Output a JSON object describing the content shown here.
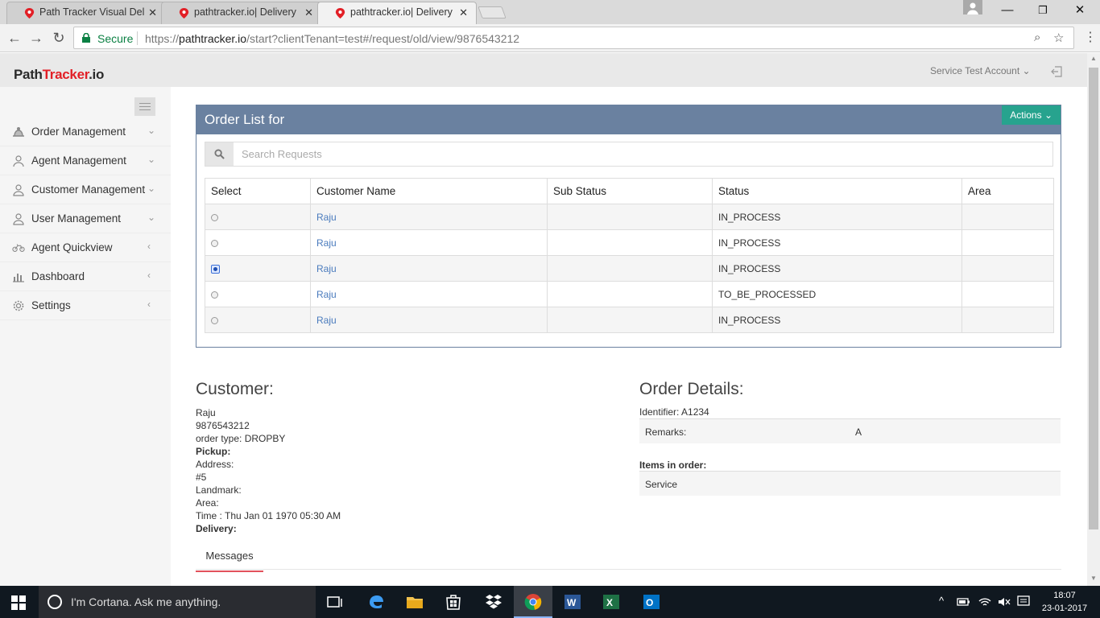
{
  "browser": {
    "tabs": [
      {
        "title": "Path Tracker Visual Delive",
        "active": false
      },
      {
        "title": "pathtracker.io| Delivery P",
        "active": false
      },
      {
        "title": "pathtracker.io| Delivery P",
        "active": true
      }
    ],
    "secure_label": "Secure",
    "url_scheme": "https://",
    "url_host": "pathtracker.io",
    "url_path": "/start?clientTenant=test#/request/old/view/9876543212"
  },
  "header": {
    "logo_part1": "Path",
    "logo_part2": "Tracker",
    "logo_part3": ".io",
    "account_label": "Service Test Account"
  },
  "sidebar": {
    "items": [
      {
        "label": "Order Management",
        "icon": "truck-icon",
        "chevron": "⌄"
      },
      {
        "label": "Agent Management",
        "icon": "agent-icon",
        "chevron": "⌄"
      },
      {
        "label": "Customer Management",
        "icon": "user-icon",
        "chevron": "⌄"
      },
      {
        "label": "User Management",
        "icon": "user-icon",
        "chevron": "⌄"
      },
      {
        "label": "Agent Quickview",
        "icon": "bike-icon",
        "chevron": "‹"
      },
      {
        "label": "Dashboard",
        "icon": "bar-chart-icon",
        "chevron": "‹"
      },
      {
        "label": "Settings",
        "icon": "gear-icon",
        "chevron": "‹"
      }
    ]
  },
  "order_list": {
    "title": "Order List for",
    "actions_label": "Actions",
    "search_placeholder": "Search Requests",
    "columns": [
      "Select",
      "Customer Name",
      "Sub Status",
      "Status",
      "Area"
    ],
    "rows": [
      {
        "selected": false,
        "customer": "Raju",
        "sub_status": "",
        "status": "IN_PROCESS",
        "area": ""
      },
      {
        "selected": false,
        "customer": "Raju",
        "sub_status": "",
        "status": "IN_PROCESS",
        "area": ""
      },
      {
        "selected": true,
        "customer": "Raju",
        "sub_status": "",
        "status": "IN_PROCESS",
        "area": ""
      },
      {
        "selected": false,
        "customer": "Raju",
        "sub_status": "",
        "status": "TO_BE_PROCESSED",
        "area": ""
      },
      {
        "selected": false,
        "customer": "Raju",
        "sub_status": "",
        "status": "IN_PROCESS",
        "area": ""
      }
    ]
  },
  "customer": {
    "heading": "Customer:",
    "name": "Raju",
    "phone": "9876543212",
    "order_type": "order type: DROPBY",
    "pickup_label": "Pickup:",
    "address_label": "Address:",
    "address_value": "#5",
    "landmark_label": "Landmark:",
    "area_label": "Area:",
    "time": "Time : Thu Jan 01 1970 05:30 AM",
    "delivery_label": "Delivery:"
  },
  "order_details": {
    "heading": "Order Details:",
    "identifier": "Identifier: A1234",
    "remarks_label": "Remarks:",
    "remarks_value": "A",
    "items_label": "Items in order:",
    "items": [
      "Service"
    ]
  },
  "messages_tab": "Messages",
  "taskbar": {
    "search_placeholder": "I'm Cortana. Ask me anything.",
    "time": "18:07",
    "date": "23-01-2017"
  },
  "colors": {
    "panel_header": "#6a81a0",
    "actions_button": "#27a38e",
    "link": "#4a7bbd",
    "brand_red": "#e21f26",
    "tab_underline": "#e2525c"
  }
}
